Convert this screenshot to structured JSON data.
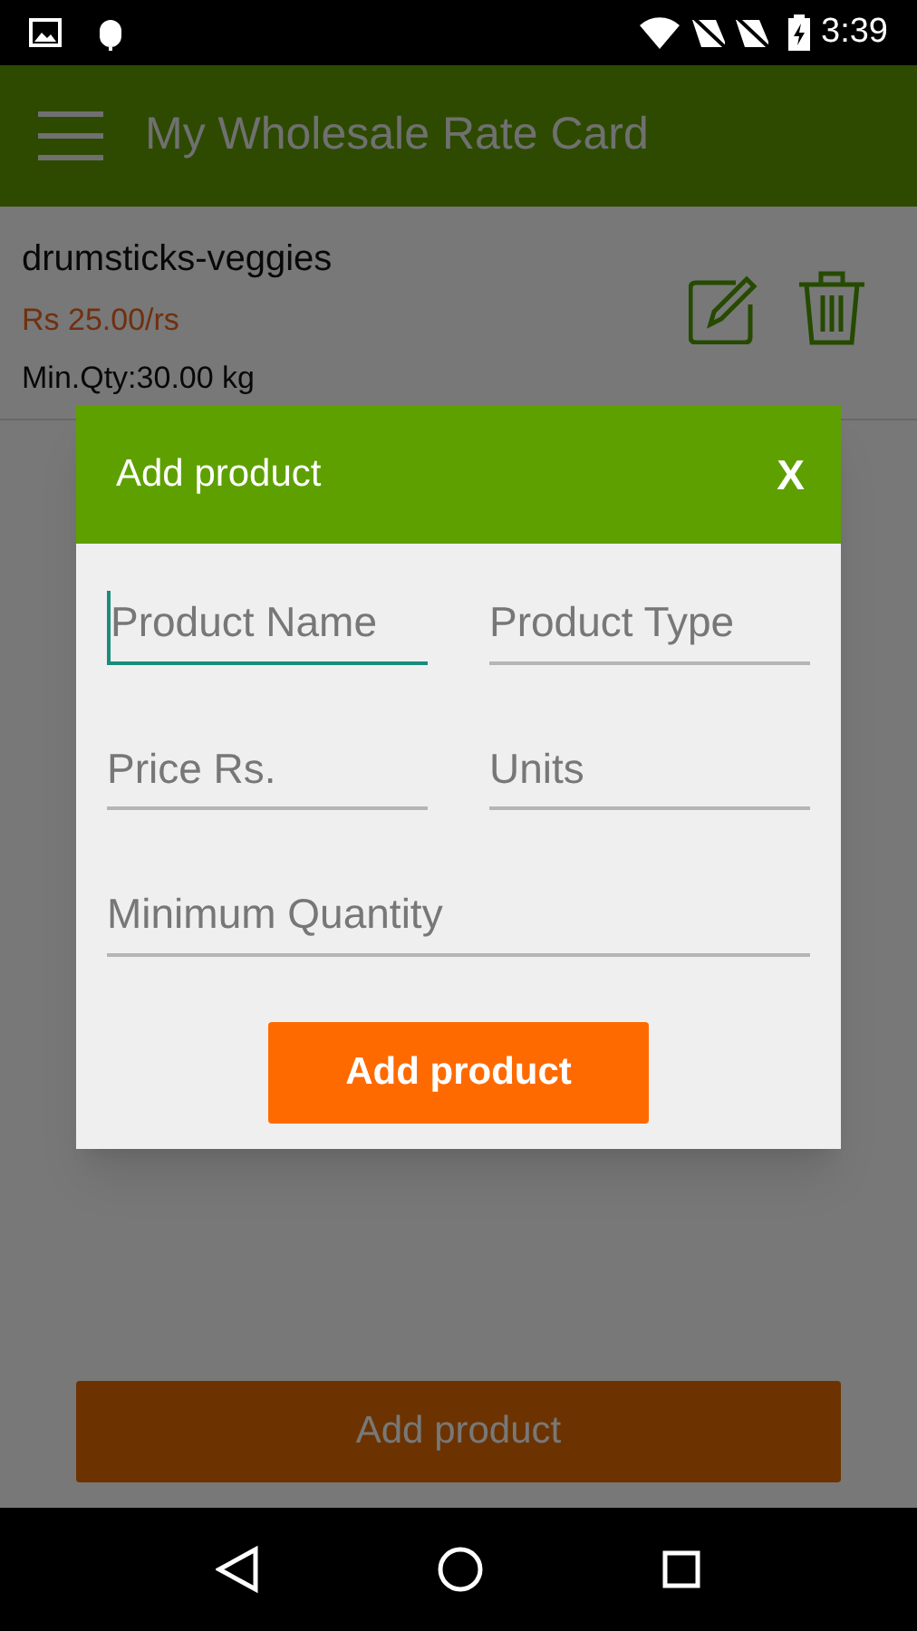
{
  "status_bar": {
    "time": "3:39"
  },
  "app_bar": {
    "title": "My Wholesale Rate Card"
  },
  "products": [
    {
      "name": "drumsticks-veggies",
      "price": "Rs 25.00/rs",
      "min_qty": "Min.Qty:30.00 kg"
    }
  ],
  "bottom_button": {
    "label": "Add product"
  },
  "dialog": {
    "title": "Add product",
    "close": "X",
    "fields": [
      {
        "placeholder": "Product Name",
        "kind": "half",
        "focused": true
      },
      {
        "placeholder": "Product Type",
        "kind": "half",
        "focused": false
      },
      {
        "placeholder": "Price Rs.",
        "kind": "half",
        "focused": false
      },
      {
        "placeholder": "Units",
        "kind": "half",
        "focused": false
      },
      {
        "placeholder": "Minimum Quantity",
        "kind": "full",
        "focused": false
      }
    ],
    "submit": "Add product"
  }
}
